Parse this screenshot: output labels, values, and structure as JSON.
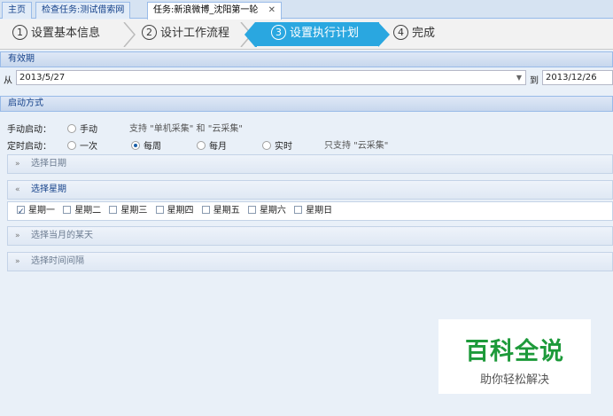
{
  "tabs": [
    {
      "label": "主页"
    },
    {
      "label": "检查任务:测试借索网"
    },
    {
      "label": "任务:新浪微博_沈阳第一轮",
      "close": "✕"
    }
  ],
  "steps": [
    {
      "num": "①",
      "label": "设置基本信息"
    },
    {
      "num": "②",
      "label": "设计工作流程"
    },
    {
      "num": "③",
      "label": "设置执行计划"
    },
    {
      "num": "④",
      "label": "完成"
    }
  ],
  "validity": {
    "title": "有效期",
    "from_label": "从",
    "from_value": "2013/5/27",
    "to_label": "到",
    "to_value": "2013/12/26"
  },
  "start": {
    "title": "启动方式",
    "manual_label": "手动启动：",
    "manual_option": "手动",
    "manual_hint": "支持 \"单机采集\" 和 \"云采集\"",
    "timed_label": "定时启动：",
    "timed_options": [
      "一次",
      "每周",
      "每月",
      "实时"
    ],
    "timed_hint": "只支持 \"云采集\"",
    "selected": "每周"
  },
  "sections": {
    "date": "选择日期",
    "week": "选择星期",
    "month_day": "选择当月的某天",
    "interval": "选择时间间隔"
  },
  "weekdays": [
    {
      "label": "星期一",
      "checked": true
    },
    {
      "label": "星期二",
      "checked": false
    },
    {
      "label": "星期三",
      "checked": false
    },
    {
      "label": "星期四",
      "checked": false
    },
    {
      "label": "星期五",
      "checked": false
    },
    {
      "label": "星期六",
      "checked": false
    },
    {
      "label": "星期日",
      "checked": false
    }
  ],
  "watermark": {
    "title": "百科全说",
    "subtitle": "助你轻松解决"
  }
}
